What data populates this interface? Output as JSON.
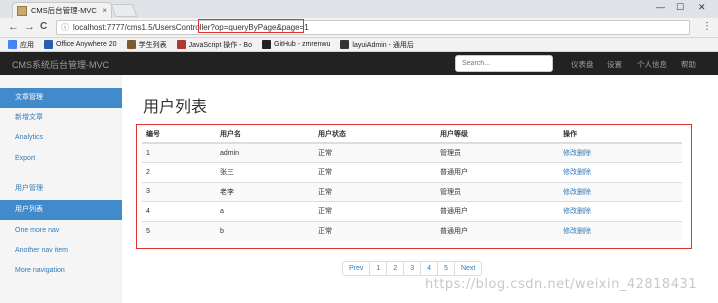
{
  "browser": {
    "tab_title": "CMS后台管理-MVC",
    "tab_close": "×",
    "url": "localhost:7777/cms1.5/UsersController?op=queryByPage&page=1",
    "window_controls": [
      "—",
      "☐",
      "✕"
    ],
    "nav": {
      "back": "←",
      "forward": "→",
      "reload": "C"
    },
    "star": "☆",
    "menu": "⋮",
    "bookmarks": [
      {
        "label": "应用",
        "icon": "apps-grid-icon",
        "color": "#4285f4"
      },
      {
        "label": "Office Anywhere 20",
        "icon": "office-icon",
        "color": "#2a5db0"
      },
      {
        "label": "学生列表",
        "icon": "page-icon",
        "color": "#7a5c2e"
      },
      {
        "label": "JavaScript 操作 - Bo",
        "icon": "page-icon",
        "color": "#b03a2e"
      },
      {
        "label": "GitHub - zmrenwu",
        "icon": "github-icon",
        "color": "#222222"
      },
      {
        "label": "layuiAdmin - 通用后",
        "icon": "page-icon",
        "color": "#333333"
      }
    ]
  },
  "navbar": {
    "brand": "CMS系统后台管理-MVC",
    "search_placeholder": "Search...",
    "links": [
      "仪表盘",
      "设置",
      "个人信息",
      "帮助"
    ]
  },
  "sidebar": {
    "items": [
      {
        "label": "文章管理",
        "active": true
      },
      {
        "label": "新增文章",
        "active": false
      },
      {
        "label": "Analytics",
        "active": false
      },
      {
        "label": "Export",
        "active": false
      },
      {
        "label": "用户管理",
        "active": false
      },
      {
        "label": "用户列表",
        "active": true
      },
      {
        "label": "One more nav",
        "active": false
      },
      {
        "label": "Another nav item",
        "active": false
      },
      {
        "label": "More navigation",
        "active": false
      }
    ]
  },
  "main": {
    "title": "用户列表",
    "columns": [
      "编号",
      "用户名",
      "用户状态",
      "用户等级",
      "操作"
    ],
    "rows": [
      [
        "1",
        "admin",
        "正常",
        "管理员",
        "修改删除"
      ],
      [
        "2",
        "张三",
        "正常",
        "普通用户",
        "修改删除"
      ],
      [
        "3",
        "老李",
        "正常",
        "管理员",
        "修改删除"
      ],
      [
        "4",
        "a",
        "正常",
        "普通用户",
        "修改删除"
      ],
      [
        "5",
        "b",
        "正常",
        "普通用户",
        "修改删除"
      ]
    ],
    "pagination": [
      "Prev",
      "1",
      "2",
      "3",
      "4",
      "5",
      "Next"
    ]
  },
  "watermark": "https://blog.csdn.net/weixin_42818431",
  "colors": {
    "accent": "#428bca",
    "highlight": "#e0322e",
    "navbar": "#222222",
    "link": "#337ab7"
  }
}
